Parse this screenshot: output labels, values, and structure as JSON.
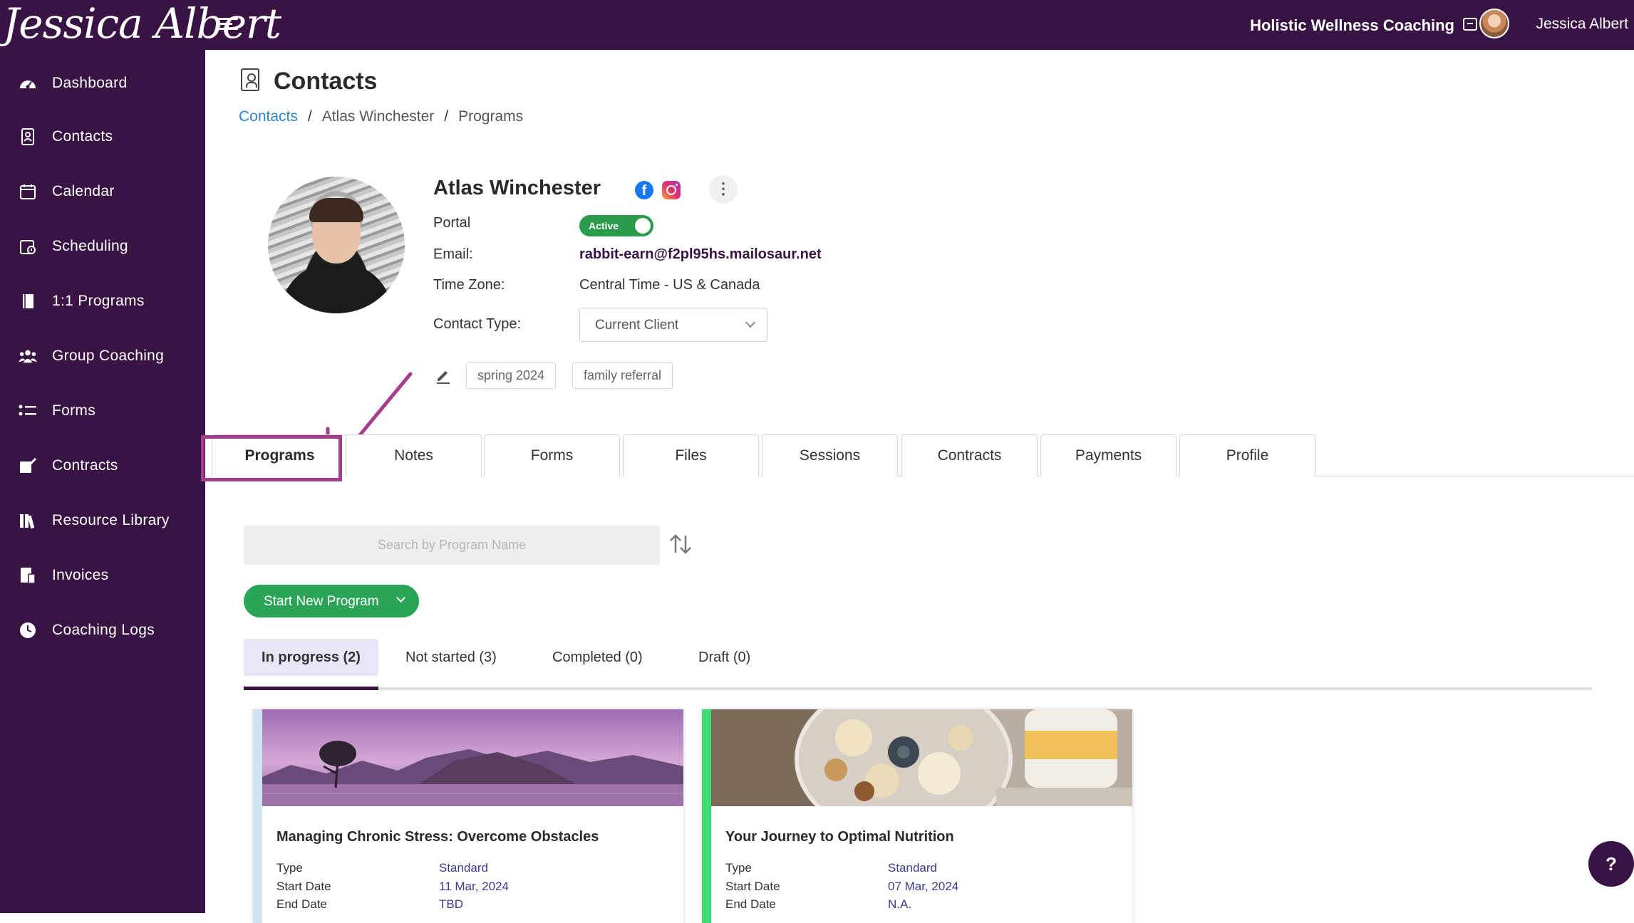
{
  "topbar": {
    "logo_text": "Jessica Albert",
    "brand_name": "Holistic Wellness Coaching",
    "user_name": "Jessica Albert"
  },
  "sidebar": {
    "items": [
      {
        "label": "Dashboard",
        "icon": "dashboard-icon"
      },
      {
        "label": "Contacts",
        "icon": "contacts-icon"
      },
      {
        "label": "Calendar",
        "icon": "calendar-icon"
      },
      {
        "label": "Scheduling",
        "icon": "scheduling-icon"
      },
      {
        "label": "1:1 Programs",
        "icon": "book-icon"
      },
      {
        "label": "Group Coaching",
        "icon": "group-icon"
      },
      {
        "label": "Forms",
        "icon": "list-icon"
      },
      {
        "label": "Contracts",
        "icon": "signature-icon"
      },
      {
        "label": "Resource Library",
        "icon": "library-icon"
      },
      {
        "label": "Invoices",
        "icon": "invoice-icon"
      },
      {
        "label": "Coaching Logs",
        "icon": "clock-icon"
      }
    ]
  },
  "page": {
    "title": "Contacts",
    "breadcrumb": {
      "root": "Contacts",
      "contact": "Atlas Winchester",
      "current": "Programs",
      "separator": "/"
    }
  },
  "contact": {
    "name": "Atlas Winchester",
    "portal_label": "Portal",
    "portal_status": "Active",
    "email_label": "Email:",
    "email": "rabbit-earn@f2pl95hs.mailosaur.net",
    "timezone_label": "Time Zone:",
    "timezone": "Central Time - US & Canada",
    "contact_type_label": "Contact Type:",
    "contact_type": "Current Client",
    "tags": [
      "spring 2024",
      "family referral"
    ]
  },
  "profile_tabs": [
    "Programs",
    "Notes",
    "Forms",
    "Files",
    "Sessions",
    "Contracts",
    "Payments",
    "Profile"
  ],
  "programs": {
    "search_placeholder": "Search by Program Name",
    "start_button": "Start New Program",
    "status_tabs": [
      "In progress (2)",
      "Not started (3)",
      "Completed (0)",
      "Draft (0)"
    ],
    "cards": [
      {
        "title": "Managing Chronic Stress: Overcome Obstacles",
        "type_label": "Type",
        "type": "Standard",
        "start_label": "Start Date",
        "start": "11 Mar, 2024",
        "end_label": "End Date",
        "end": "TBD",
        "accent": "#cfe3f1"
      },
      {
        "title": "Your Journey to Optimal Nutrition",
        "type_label": "Type",
        "type": "Standard",
        "start_label": "Start Date",
        "start": "07 Mar, 2024",
        "end_label": "End Date",
        "end": "N.A.",
        "accent": "#3fdc73"
      }
    ]
  },
  "help_label": "?",
  "colors": {
    "primary": "#3a1345",
    "active_green": "#2a9a4b",
    "link_blue": "#2f86c8",
    "highlight_magenta": "#a43e8a"
  }
}
